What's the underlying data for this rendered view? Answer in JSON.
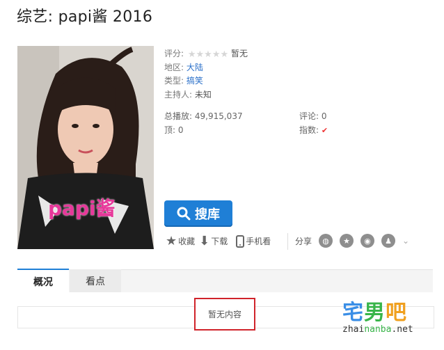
{
  "page": {
    "title": "综艺: papi酱 2016"
  },
  "poster": {
    "overlay_text": "papi酱"
  },
  "info": {
    "rating_label": "评分:",
    "rating_stars": "★★★★★",
    "rating_value": "暂无",
    "region_label": "地区:",
    "region_value": "大陆",
    "genre_label": "类型:",
    "genre_value": "搞笑",
    "host_label": "主持人:",
    "host_value": "未知"
  },
  "stats": {
    "plays_label": "总播放:",
    "plays_value": "49,915,037",
    "comments_label": "评论:",
    "comments_value": "0",
    "likes_label": "顶:",
    "likes_value": "0",
    "index_label": "指数:",
    "index_icon": "v-index-icon"
  },
  "search_button": {
    "label": "搜库",
    "icon": "search-icon"
  },
  "actions": {
    "favorite": "收藏",
    "download": "下载",
    "mobile": "手机看",
    "share": "分享"
  },
  "share_icons": [
    "wechat-icon",
    "star-icon",
    "weibo-icon",
    "qq-icon",
    "chevron-down-icon"
  ],
  "tabs": [
    {
      "label": "概况",
      "active": true
    },
    {
      "label": "看点",
      "active": false
    }
  ],
  "content": {
    "empty_text": "暂无内容"
  },
  "watermark": {
    "logo_1": "宅",
    "logo_2": "男",
    "logo_3": "吧",
    "url_1": "zhai",
    "url_2": "nanba",
    "url_3": ".net"
  },
  "colors": {
    "accent": "#1f7fd6",
    "link": "#2a6fc9",
    "highlight_border": "#d0232a"
  }
}
